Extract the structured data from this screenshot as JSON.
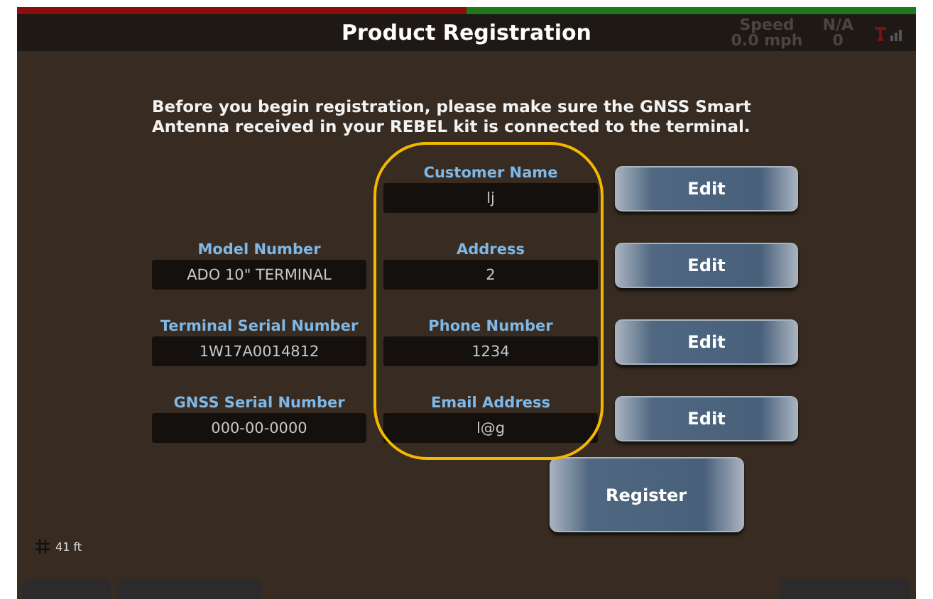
{
  "window": {
    "title": "Product Registration"
  },
  "status": [
    {
      "label": "Speed",
      "value": "0.0 mph"
    },
    {
      "label": "N/A",
      "value": "0"
    }
  ],
  "instruction": "Before you begin registration, please make sure the GNSS Smart Antenna received in your REBEL kit is connected to the terminal.",
  "device_fields": [
    {
      "label": "Model Number",
      "value": "ADO 10\" TERMINAL"
    },
    {
      "label": "Terminal Serial Number",
      "value": "1W17A0014812"
    },
    {
      "label": "GNSS Serial Number",
      "value": "000-00-0000"
    }
  ],
  "customer_fields": [
    {
      "label": "Customer Name",
      "value": "lj",
      "button": "Edit"
    },
    {
      "label": "Address",
      "value": "2",
      "button": "Edit"
    },
    {
      "label": "Phone Number",
      "value": "1234",
      "button": "Edit"
    },
    {
      "label": "Email Address",
      "value": "l@g",
      "button": "Edit"
    }
  ],
  "register_button": "Register",
  "scale": "41 ft"
}
